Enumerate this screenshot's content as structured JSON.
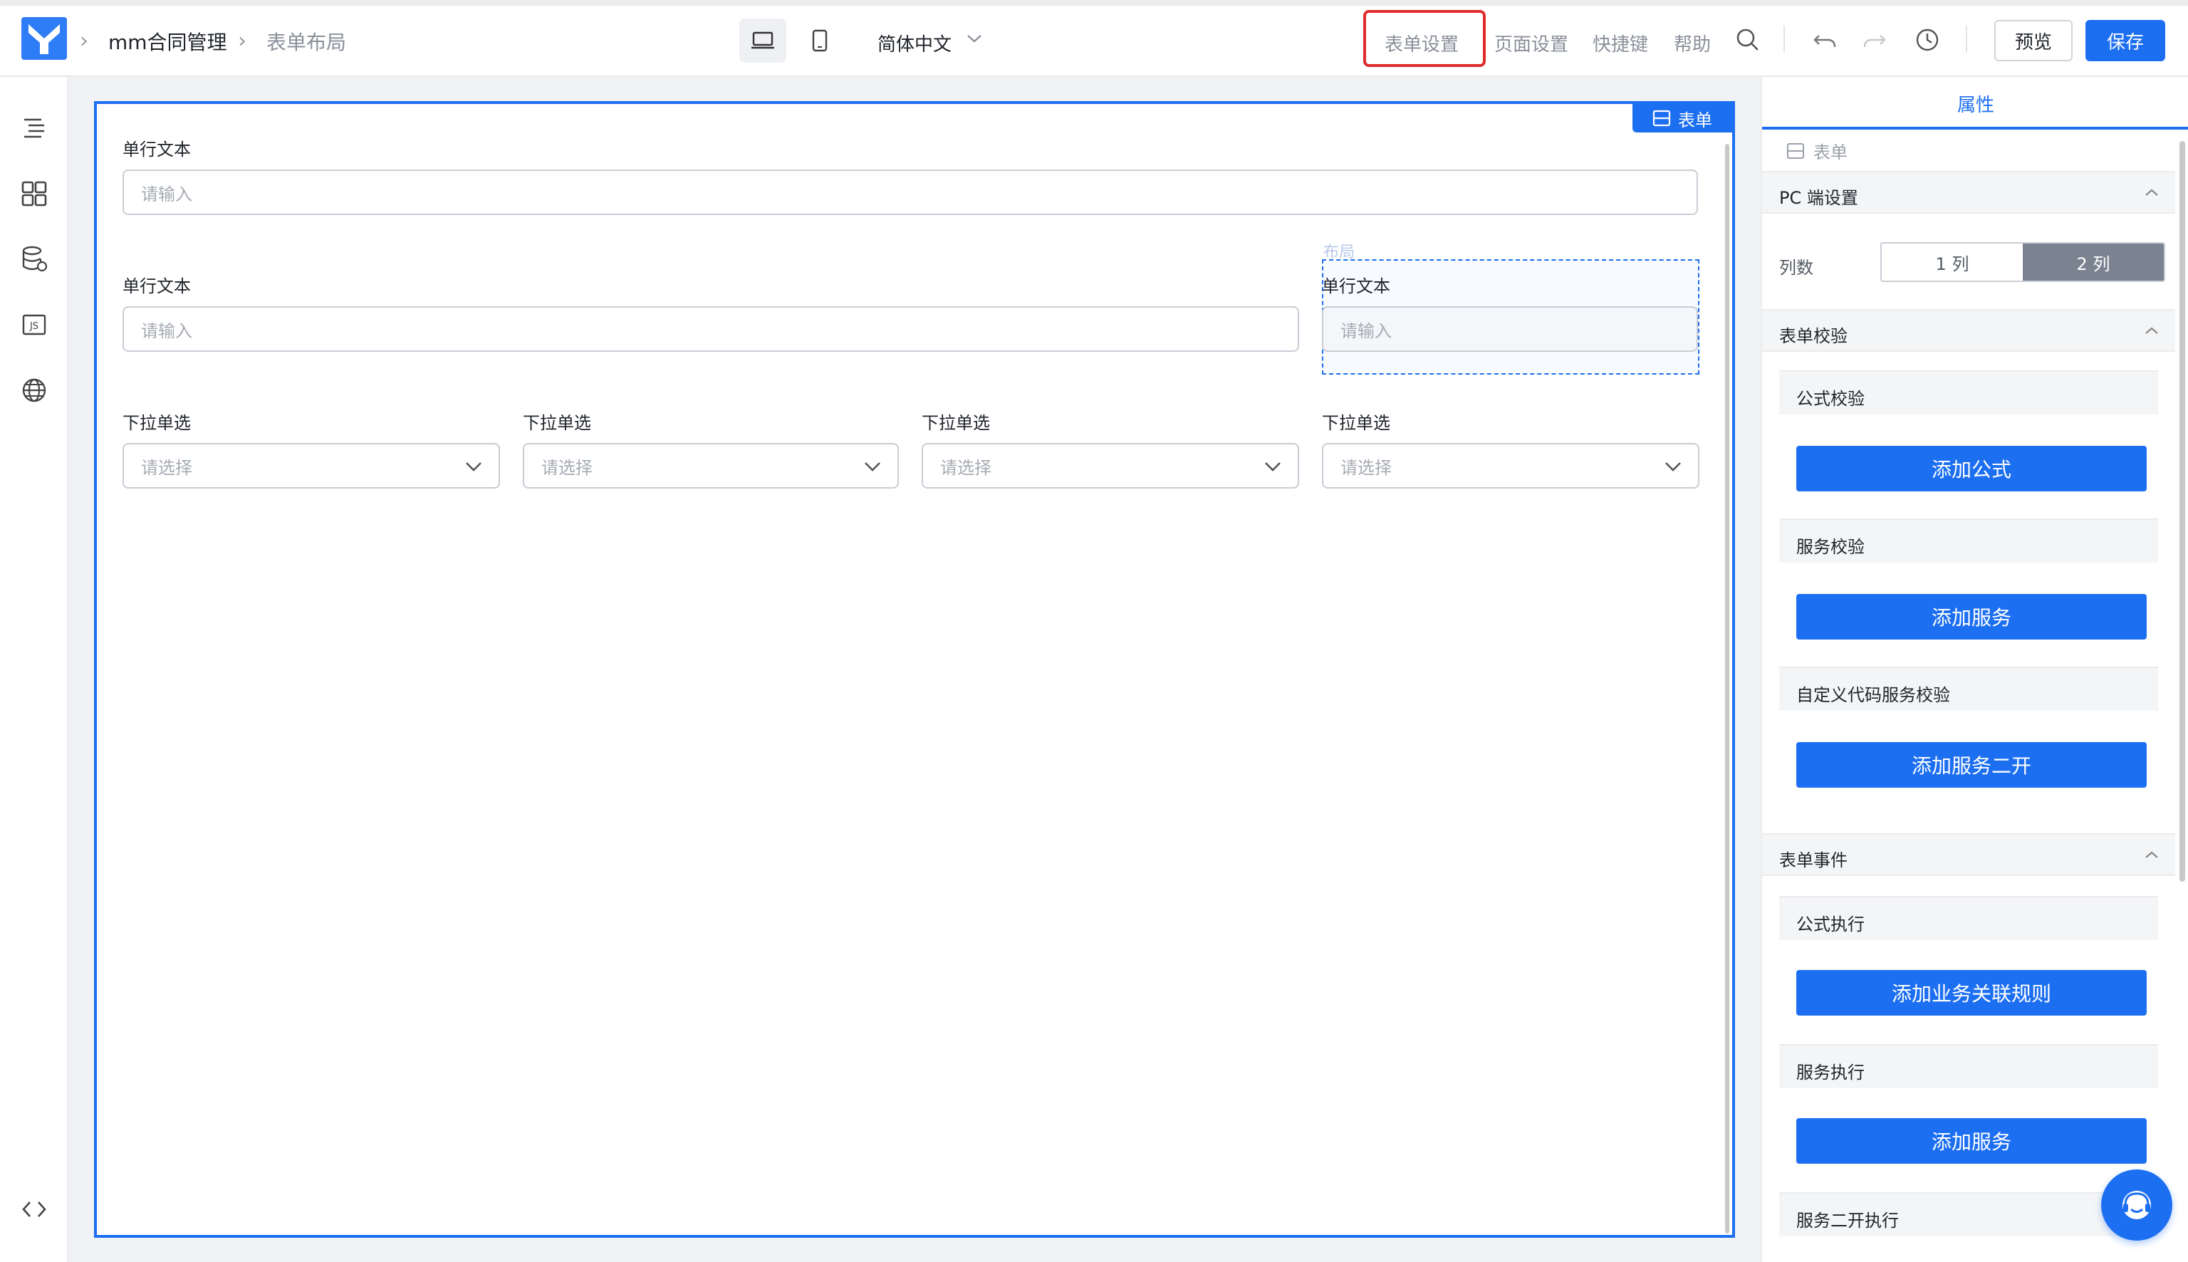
{
  "breadcrumb": {
    "app": "mm合同管理",
    "page": "表单布局"
  },
  "toolbar": {
    "language": "简体中文",
    "form_settings": "表单设置",
    "page_settings": "页面设置",
    "shortcuts": "快捷键",
    "help": "帮助",
    "preview": "预览",
    "save": "保存"
  },
  "canvas": {
    "tag": "表单",
    "layout_tag": "布局",
    "fields": [
      {
        "label": "单行文本",
        "placeholder": "请输入"
      },
      {
        "label": "单行文本",
        "placeholder": "请输入"
      },
      {
        "label": "单行文本",
        "placeholder": "请输入"
      }
    ],
    "selects": [
      {
        "label": "下拉单选",
        "placeholder": "请选择"
      },
      {
        "label": "下拉单选",
        "placeholder": "请选择"
      },
      {
        "label": "下拉单选",
        "placeholder": "请选择"
      },
      {
        "label": "下拉单选",
        "placeholder": "请选择"
      }
    ]
  },
  "panel": {
    "tab": "属性",
    "crumb": "表单",
    "pc_settings": {
      "title": "PC 端设置",
      "columns_label": "列数",
      "options": [
        "1 列",
        "2 列"
      ],
      "selected": "2 列"
    },
    "validation": {
      "title": "表单校验",
      "groups": [
        {
          "title": "公式校验",
          "button": "添加公式"
        },
        {
          "title": "服务校验",
          "button": "添加服务"
        },
        {
          "title": "自定义代码服务校验",
          "button": "添加服务二开"
        }
      ]
    },
    "events": {
      "title": "表单事件",
      "groups": [
        {
          "title": "公式执行",
          "button": "添加业务关联规则"
        },
        {
          "title": "服务执行",
          "button": "添加服务"
        },
        {
          "title": "服务二开执行"
        }
      ]
    }
  },
  "colors": {
    "accent": "#1d6ff2",
    "highlight": "#e02b2b"
  }
}
